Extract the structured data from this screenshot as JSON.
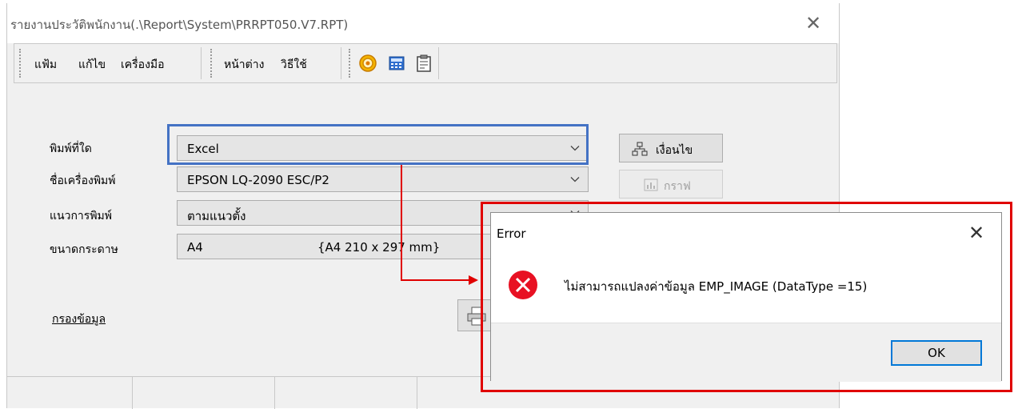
{
  "window": {
    "title": "รายงานประวัติพนักงาน(.\\Report\\System\\PRRPT050.V7.RPT)",
    "close_glyph": "✕"
  },
  "toolbar": {
    "menu": [
      "แฟ้ม",
      "แก้ไข",
      "เครื่องมือ",
      "หน้าต่าง",
      "วิธีใช้"
    ],
    "icons": [
      "target-icon",
      "calculator-icon",
      "clipboard-icon"
    ]
  },
  "form": {
    "print_to": {
      "label": "พิมพ์ที่ใด",
      "value": "Excel"
    },
    "printer_name": {
      "label": "ชื่อเครื่องพิมพ์",
      "value": "EPSON LQ-2090 ESC/P2"
    },
    "orientation": {
      "label": "แนวการพิมพ์",
      "value": "ตามแนวตั้ง"
    },
    "paper_size": {
      "label": "ขนาดกระดาษ",
      "value": "A4",
      "dimensions": "{A4 210 x 297 mm}"
    }
  },
  "buttons": {
    "condition": "เงื่อนไข",
    "graph": "กราฟ"
  },
  "filter_link": "กรองข้อมูล",
  "dialog": {
    "title": "Error",
    "close_glyph": "✕",
    "message": "ไม่สามารถแปลงค่าข้อมูล EMP_IMAGE (DataType =15)",
    "ok_label": "OK"
  },
  "colors": {
    "highlight_blue": "#4472c4",
    "highlight_red": "#e00000",
    "error_icon": "#e81123",
    "focus_blue": "#0078d7"
  }
}
